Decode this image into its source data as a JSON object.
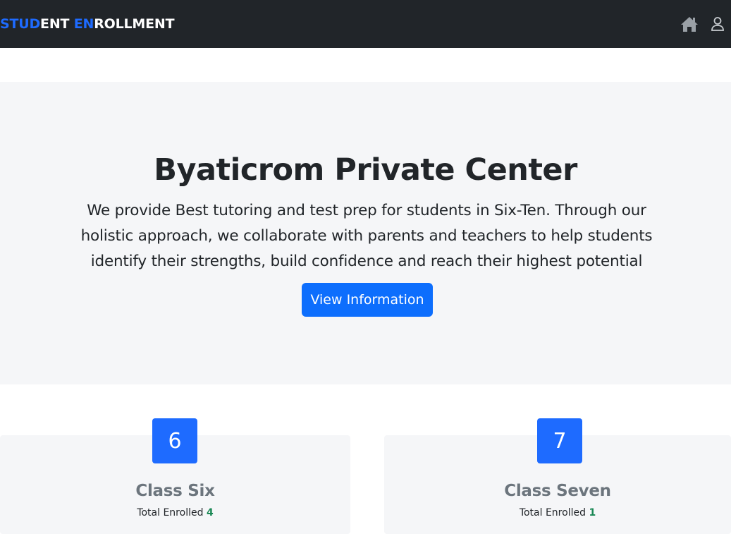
{
  "navbar": {
    "brand_parts": [
      {
        "text": "STUD",
        "color": "#1e6bff"
      },
      {
        "text": "ENT ",
        "color": "#ffffff"
      },
      {
        "text": "EN",
        "color": "#1e6bff"
      },
      {
        "text": "ROLLMENT",
        "color": "#ffffff"
      }
    ],
    "icons": [
      "home-icon",
      "user-icon"
    ]
  },
  "hero": {
    "title": "Byaticrom Private Center",
    "description": "We provide Best tutoring and test prep for students in Six-Ten. Through our holistic approach, we collaborate with parents and teachers to help students identify their strengths, build confidence and reach their highest potential",
    "button_label": "View Information"
  },
  "classes": [
    {
      "number": "6",
      "title": "Class Six",
      "enrolled_label": "Total Enrolled",
      "enrolled_count": "4"
    },
    {
      "number": "7",
      "title": "Class Seven",
      "enrolled_label": "Total Enrolled",
      "enrolled_count": "1"
    }
  ],
  "colors": {
    "navbar_bg": "#212529",
    "accent": "#0d6efd",
    "count_green": "#198754"
  }
}
